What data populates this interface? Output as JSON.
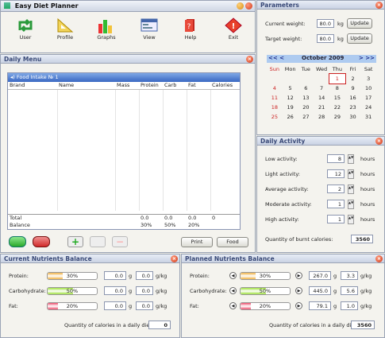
{
  "app": {
    "title": "Easy Diet Planner"
  },
  "toolbar": [
    {
      "label": "User",
      "icon": "user-icon"
    },
    {
      "label": "Profile",
      "icon": "profile-icon"
    },
    {
      "label": "Graphs",
      "icon": "graphs-icon"
    },
    {
      "label": "View",
      "icon": "view-icon"
    },
    {
      "label": "Help",
      "icon": "help-icon"
    },
    {
      "label": "Exit",
      "icon": "exit-icon"
    }
  ],
  "parameters": {
    "title": "Parameters",
    "current_label": "Current weight:",
    "current_value": "80.0",
    "target_label": "Target weight:",
    "target_value": "80.0",
    "unit": "kg",
    "update": "Update"
  },
  "calendar": {
    "prev": "<< <",
    "month": "October 2009",
    "next": "> >>",
    "days": [
      "Sun",
      "Mon",
      "Tue",
      "Wed",
      "Thu",
      "Fri",
      "Sat"
    ],
    "weeks": [
      [
        "",
        "",
        "",
        "",
        "1",
        "2",
        "3"
      ],
      [
        "4",
        "5",
        "6",
        "7",
        "8",
        "9",
        "10"
      ],
      [
        "11",
        "12",
        "13",
        "14",
        "15",
        "16",
        "17"
      ],
      [
        "18",
        "19",
        "20",
        "21",
        "22",
        "23",
        "24"
      ],
      [
        "25",
        "26",
        "27",
        "28",
        "29",
        "30",
        "31"
      ]
    ],
    "today": "1"
  },
  "daily_menu": {
    "title": "Daily Menu",
    "intake": "Food Intake № 1",
    "columns": [
      "Brand",
      "Name",
      "Mass",
      "Protein",
      "Carb",
      "Fat",
      "Calories"
    ],
    "total_label": "Total",
    "total": [
      "0.0",
      "0.0",
      "0.0",
      "0"
    ],
    "balance_label": "Balance",
    "balance": [
      "30%",
      "50%",
      "20%"
    ],
    "print": "Print",
    "food": "Food"
  },
  "activity": {
    "title": "Daily Activity",
    "unit": "hours",
    "items": [
      {
        "label": "Low activity:",
        "value": "8"
      },
      {
        "label": "Light activity:",
        "value": "12"
      },
      {
        "label": "Average activity:",
        "value": "2"
      },
      {
        "label": "Moderate activity:",
        "value": "1"
      },
      {
        "label": "High activity:",
        "value": "1"
      }
    ],
    "burnt_label": "Quantity of burnt calories:",
    "burnt": "3560"
  },
  "current": {
    "title": "Current Nutrients Balance",
    "rows": [
      {
        "label": "Protein:",
        "pct": "30%",
        "fill": 0.3,
        "color": "#f0b040",
        "grams": "0.0",
        "gkg": "0.0"
      },
      {
        "label": "Carbohydrate:",
        "pct": "50%",
        "fill": 0.5,
        "color": "#9ee03a",
        "grams": "0.0",
        "gkg": "0.0"
      },
      {
        "label": "Fat:",
        "pct": "20%",
        "fill": 0.2,
        "color": "#ee4a6a",
        "grams": "0.0",
        "gkg": "0.0"
      }
    ],
    "g": "g",
    "gkgu": "g/kg",
    "total_label": "Quantity of calories in a daily diet:",
    "total": "0"
  },
  "planned": {
    "title": "Planned Nutrients Balance",
    "rows": [
      {
        "label": "Protein:",
        "pct": "30%",
        "fill": 0.3,
        "color": "#f0b040",
        "grams": "267.0",
        "gkg": "3.3"
      },
      {
        "label": "Carbohydrate:",
        "pct": "50%",
        "fill": 0.5,
        "color": "#9ee03a",
        "grams": "445.0",
        "gkg": "5.6"
      },
      {
        "label": "Fat:",
        "pct": "20%",
        "fill": 0.2,
        "color": "#ee4a6a",
        "grams": "79.1",
        "gkg": "1.0"
      }
    ],
    "g": "g",
    "gkgu": "g/kg",
    "total_label": "Quantity of calories in a daily diet:",
    "total": "3560"
  }
}
